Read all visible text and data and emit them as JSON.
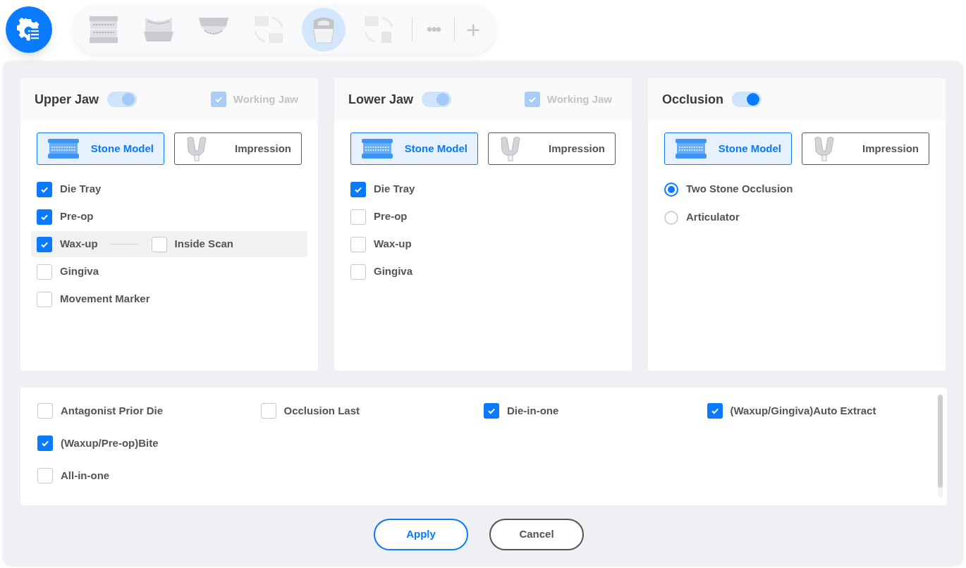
{
  "toolbar": {
    "tools": [
      {
        "kind": "full-jaw",
        "selected": false,
        "disabled": false
      },
      {
        "kind": "lower-jaw",
        "selected": false,
        "disabled": false
      },
      {
        "kind": "upper-jaw",
        "selected": false,
        "disabled": false
      },
      {
        "kind": "split-jaw",
        "selected": false,
        "disabled": true
      },
      {
        "kind": "die",
        "selected": true,
        "disabled": false
      },
      {
        "kind": "split-die",
        "selected": false,
        "disabled": true
      }
    ],
    "more": "•••",
    "add": "+"
  },
  "panels": [
    {
      "title": "Upper Jaw",
      "toggle": {
        "on": true,
        "disabled": true
      },
      "working_jaw": {
        "label": "Working Jaw",
        "checked": true,
        "disabled": true
      },
      "model_buttons": [
        {
          "kind": "stone",
          "label": "Stone Model",
          "selected": true
        },
        {
          "kind": "impression",
          "label": "Impression",
          "selected": false
        }
      ],
      "options": [
        {
          "kind": "checkbox",
          "label": "Die Tray",
          "checked": true
        },
        {
          "kind": "checkbox",
          "label": "Pre-op",
          "checked": true
        },
        {
          "kind": "checkbox",
          "label": "Wax-up",
          "checked": true,
          "sub_option": {
            "label": "Inside Scan",
            "checked": false
          }
        },
        {
          "kind": "checkbox",
          "label": "Gingiva",
          "checked": false
        },
        {
          "kind": "checkbox",
          "label": "Movement Marker",
          "checked": false
        }
      ]
    },
    {
      "title": "Lower Jaw",
      "toggle": {
        "on": true,
        "disabled": true
      },
      "working_jaw": {
        "label": "Working Jaw",
        "checked": true,
        "disabled": true
      },
      "model_buttons": [
        {
          "kind": "stone",
          "label": "Stone Model",
          "selected": true
        },
        {
          "kind": "impression",
          "label": "Impression",
          "selected": false
        }
      ],
      "options": [
        {
          "kind": "checkbox",
          "label": "Die Tray",
          "checked": true
        },
        {
          "kind": "checkbox",
          "label": "Pre-op",
          "checked": false
        },
        {
          "kind": "checkbox",
          "label": "Wax-up",
          "checked": false
        },
        {
          "kind": "checkbox",
          "label": "Gingiva",
          "checked": false
        }
      ]
    },
    {
      "title": "Occlusion",
      "toggle": {
        "on": true,
        "disabled": false
      },
      "model_buttons": [
        {
          "kind": "stone",
          "label": "Stone Model",
          "selected": true
        },
        {
          "kind": "impression",
          "label": "Impression",
          "selected": false
        }
      ],
      "options": [
        {
          "kind": "radio",
          "label": "Two Stone Occlusion",
          "selected": true
        },
        {
          "kind": "radio",
          "label": "Articulator",
          "selected": false
        }
      ]
    }
  ],
  "extra_options": {
    "rows": [
      [
        {
          "label": "Antagonist Prior Die",
          "checked": false
        },
        {
          "label": "Occlusion Last",
          "checked": false
        },
        {
          "label": "Die-in-one",
          "checked": true
        },
        {
          "label": "(Waxup/Gingiva)Auto Extract",
          "checked": true
        }
      ],
      [
        {
          "label": "(Waxup/Pre-op)Bite",
          "checked": true
        }
      ],
      [
        {
          "label": "All-in-one",
          "checked": false
        }
      ]
    ]
  },
  "buttons": [
    {
      "kind": "primary",
      "label": "Apply"
    },
    {
      "kind": "secondary",
      "label": "Cancel"
    }
  ]
}
